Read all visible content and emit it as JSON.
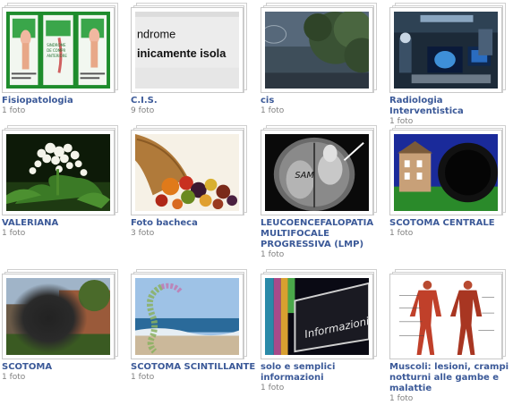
{
  "albums": [
    {
      "title": "Fisiopatologia",
      "count": "1 foto",
      "thumb_icon": "medical-poster-thumbnail",
      "thumb_text": [
        "SINDROME",
        "DE COMPR",
        "ANTERIORE"
      ]
    },
    {
      "title": "C.I.S.",
      "count": "9 foto",
      "thumb_icon": "document-text-thumbnail",
      "thumb_text": [
        "ndrome",
        "inicamente isola"
      ]
    },
    {
      "title": "cis",
      "count": "1 foto",
      "thumb_icon": "tree-dusk-thumbnail"
    },
    {
      "title": "Radiologia Interventistica",
      "count": "1 foto",
      "thumb_icon": "operating-room-thumbnail"
    },
    {
      "title": "VALERIANA",
      "count": "1 foto",
      "thumb_icon": "white-flower-thumbnail"
    },
    {
      "title": "Foto bacheca",
      "count": "3 foto",
      "thumb_icon": "cornucopia-thumbnail"
    },
    {
      "title": "LEUCOENCEFALOPATIA MULTIFOCALE PROGRESSIVA (LMP)",
      "count": "1 foto",
      "thumb_icon": "brain-scan-thumbnail",
      "thumb_text": [
        "SAM"
      ]
    },
    {
      "title": "SCOTOMA CENTRALE",
      "count": "1 foto",
      "thumb_icon": "scotoma-building-thumbnail"
    },
    {
      "title": "SCOTOMA",
      "count": "1 foto",
      "thumb_icon": "scotoma-house-thumbnail"
    },
    {
      "title": "SCOTOMA SCINTILLANTE",
      "count": "1 foto",
      "thumb_icon": "beach-scintillating-thumbnail"
    },
    {
      "title": "solo e semplici informazioni",
      "count": "1 foto",
      "thumb_icon": "informazioni-sign-thumbnail",
      "thumb_text": [
        "Informazioni"
      ]
    },
    {
      "title": "Muscoli: lesioni, crampi notturni alle gambe e malattie",
      "count": "1 foto",
      "thumb_icon": "muscle-anatomy-thumbnail"
    }
  ]
}
